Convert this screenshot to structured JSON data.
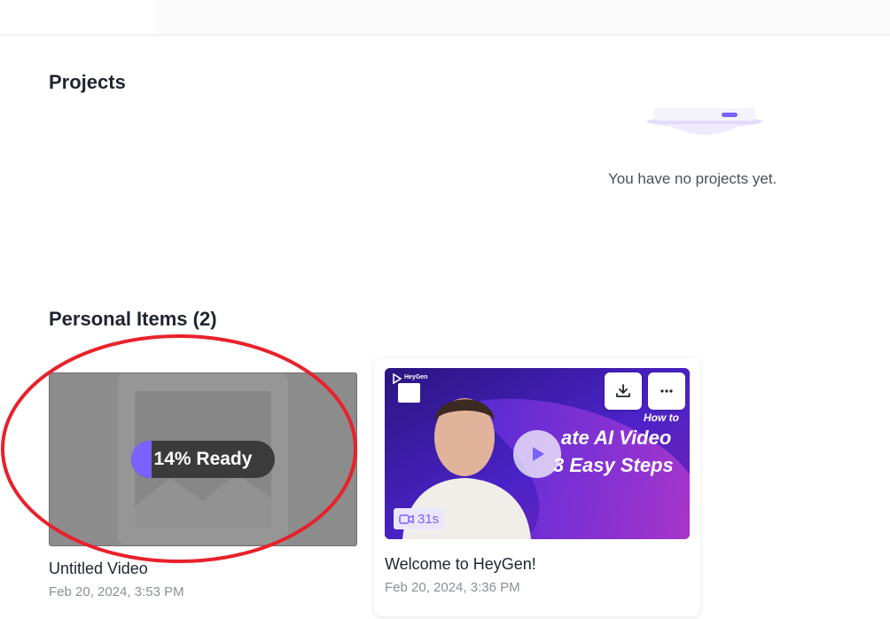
{
  "projects": {
    "title": "Projects",
    "empty_text": "You have no projects yet."
  },
  "personal": {
    "title": "Personal Items (2)",
    "items": [
      {
        "title": "Untitled Video",
        "date": "Feb 20, 2024, 3:53 PM",
        "progress_label": "14% Ready",
        "progress_fraction": 0.14
      },
      {
        "title": "Welcome to HeyGen!",
        "date": "Feb 20, 2024, 3:36 PM",
        "duration": "31s",
        "thumb_brand": "HeyGen",
        "thumb_heading_small": "How to",
        "thumb_heading_line1": "ate AI Video",
        "thumb_heading_line2": "3 Easy Steps"
      }
    ]
  },
  "colors": {
    "accent": "#7b61ff",
    "annotation": "#e8212b"
  },
  "icons": [
    "download-icon",
    "more-icon",
    "play-icon",
    "video-camera-icon",
    "heygen-logo-icon"
  ]
}
